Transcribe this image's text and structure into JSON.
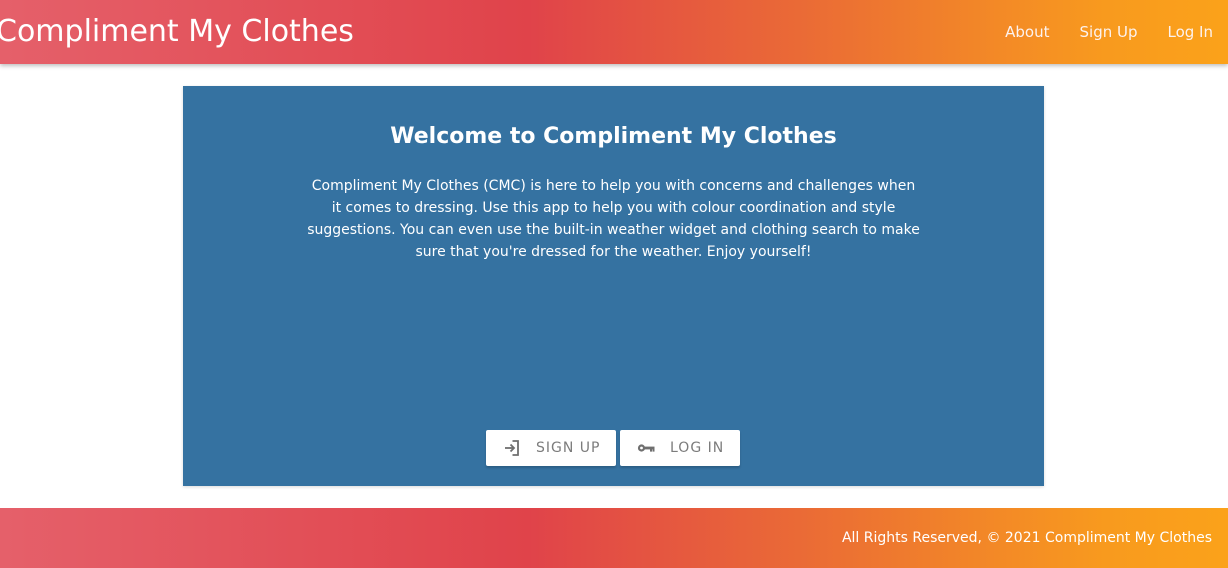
{
  "header": {
    "brand": "Compliment My Clothes",
    "nav": [
      {
        "label": "About"
      },
      {
        "label": "Sign Up"
      },
      {
        "label": "Log In"
      }
    ]
  },
  "main": {
    "title": "Welcome to Compliment My Clothes",
    "description": "Compliment My Clothes (CMC) is here to help you with concerns and challenges when it comes to dressing. Use this app to help you with colour coordination and style suggestions. You can even use the built-in weather widget and clothing search to make sure that you're dressed for the weather. Enjoy yourself!",
    "buttons": {
      "signup": {
        "label": "SIGN UP",
        "icon": "login-arrow-icon"
      },
      "login": {
        "label": "LOG IN",
        "icon": "key-icon"
      }
    }
  },
  "footer": {
    "text": "All Rights Reserved, © 2021 Compliment My Clothes"
  },
  "colors": {
    "gradient_start": "#e5606a",
    "gradient_mid": "#e0434a",
    "gradient_end": "#fba21a",
    "card_background": "#3572a1",
    "button_text": "#7c7c7c"
  }
}
